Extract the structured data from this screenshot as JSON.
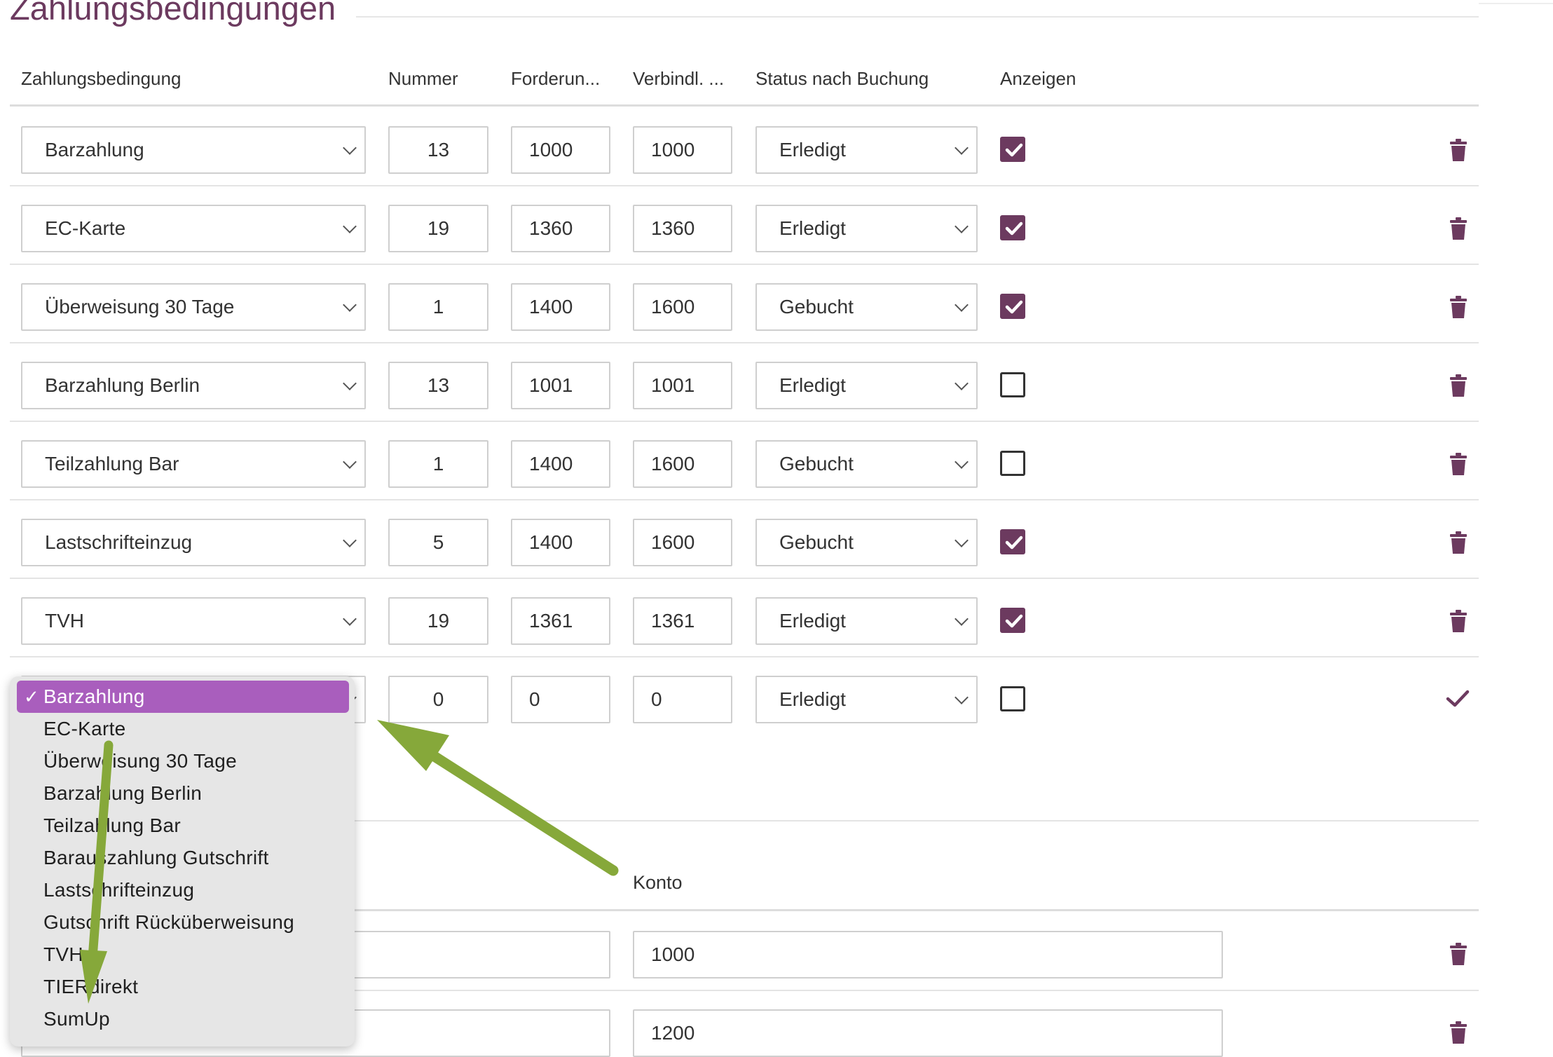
{
  "section": {
    "title": "Zahlungsbedingungen"
  },
  "columns": {
    "zahlungsbedingung": "Zahlungsbedingung",
    "nummer": "Nummer",
    "forderung": "Forderun...",
    "verbindlichkeit": "Verbindl. ...",
    "status": "Status nach Buchung",
    "anzeigen": "Anzeigen"
  },
  "rows": [
    {
      "zahlungsbedingung": "Barzahlung",
      "nummer": "13",
      "forderung": "1000",
      "verbindlichkeit": "1000",
      "status": "Erledigt",
      "anzeigen": true
    },
    {
      "zahlungsbedingung": "EC-Karte",
      "nummer": "19",
      "forderung": "1360",
      "verbindlichkeit": "1360",
      "status": "Erledigt",
      "anzeigen": true
    },
    {
      "zahlungsbedingung": "Überweisung 30 Tage",
      "nummer": "1",
      "forderung": "1400",
      "verbindlichkeit": "1600",
      "status": "Gebucht",
      "anzeigen": true
    },
    {
      "zahlungsbedingung": "Barzahlung Berlin",
      "nummer": "13",
      "forderung": "1001",
      "verbindlichkeit": "1001",
      "status": "Erledigt",
      "anzeigen": false
    },
    {
      "zahlungsbedingung": "Teilzahlung Bar",
      "nummer": "1",
      "forderung": "1400",
      "verbindlichkeit": "1600",
      "status": "Gebucht",
      "anzeigen": false
    },
    {
      "zahlungsbedingung": "Lastschrifteinzug",
      "nummer": "5",
      "forderung": "1400",
      "verbindlichkeit": "1600",
      "status": "Gebucht",
      "anzeigen": true
    },
    {
      "zahlungsbedingung": "TVH",
      "nummer": "19",
      "forderung": "1361",
      "verbindlichkeit": "1361",
      "status": "Erledigt",
      "anzeigen": true
    }
  ],
  "new_row": {
    "nummer": "0",
    "forderung": "0",
    "verbindlichkeit": "0",
    "status": "Erledigt",
    "anzeigen": false
  },
  "dropdown": {
    "selected_mark": "✓",
    "options": [
      "Barzahlung",
      "EC-Karte",
      "Überweisung 30 Tage",
      "Barzahlung Berlin",
      "Teilzahlung Bar",
      "Barauszahlung Gutschrift",
      "Lastschrifteinzug",
      "Gutschrift Rücküberweisung",
      "TVH",
      "TIERdirekt",
      "SumUp"
    ],
    "selected_index": 0
  },
  "konto_section": {
    "header": "Konto",
    "rows": [
      {
        "konto": "1000"
      },
      {
        "konto": "1200"
      }
    ]
  },
  "colors": {
    "accent": "#6c3a5f",
    "dropdown_selected": "#a95ebd",
    "arrow": "#86a83a"
  }
}
